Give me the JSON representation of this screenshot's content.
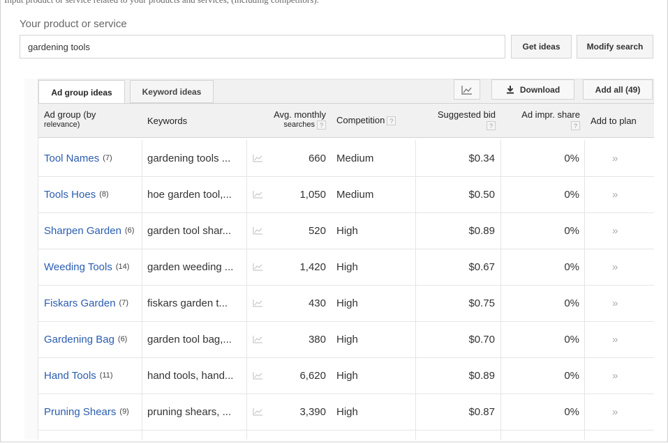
{
  "top_clip_text": "Input product or service related to your products and services, (including competitors).",
  "product": {
    "label": "Your product or service",
    "value": "gardening tools",
    "get_ideas": "Get ideas",
    "modify_search": "Modify search"
  },
  "tabs": {
    "ad_group": "Ad group ideas",
    "keyword": "Keyword ideas"
  },
  "toolbar": {
    "chart_icon": "chart-icon",
    "download": "Download",
    "add_all": "Add all (49)"
  },
  "headers": {
    "ad_group_line1": "Ad group (by",
    "ad_group_line2": "relevance)",
    "keywords": "Keywords",
    "searches_line1": "Avg. monthly",
    "searches_line2": "searches",
    "competition": "Competition",
    "bid": "Suggested bid",
    "share": "Ad impr. share",
    "add_to_plan": "Add to plan",
    "help": "?"
  },
  "rows": [
    {
      "name": "Tool Names",
      "count": "(7)",
      "keywords": "gardening tools ...",
      "searches": "660",
      "competition": "Medium",
      "bid": "$0.34",
      "share": "0%",
      "add": "»"
    },
    {
      "name": "Tools Hoes",
      "count": "(8)",
      "keywords": "hoe garden tool,...",
      "searches": "1,050",
      "competition": "Medium",
      "bid": "$0.50",
      "share": "0%",
      "add": "»"
    },
    {
      "name": "Sharpen Garden",
      "count": "(6)",
      "keywords": "garden tool shar...",
      "searches": "520",
      "competition": "High",
      "bid": "$0.89",
      "share": "0%",
      "add": "»"
    },
    {
      "name": "Weeding Tools",
      "count": "(14)",
      "keywords": "garden weeding ...",
      "searches": "1,420",
      "competition": "High",
      "bid": "$0.67",
      "share": "0%",
      "add": "»"
    },
    {
      "name": "Fiskars Garden",
      "count": "(7)",
      "keywords": "fiskars garden t...",
      "searches": "430",
      "competition": "High",
      "bid": "$0.75",
      "share": "0%",
      "add": "»"
    },
    {
      "name": "Gardening Bag",
      "count": "(6)",
      "keywords": "garden tool bag,...",
      "searches": "380",
      "competition": "High",
      "bid": "$0.70",
      "share": "0%",
      "add": "»"
    },
    {
      "name": "Hand Tools",
      "count": "(11)",
      "keywords": "hand tools, hand...",
      "searches": "6,620",
      "competition": "High",
      "bid": "$0.89",
      "share": "0%",
      "add": "»"
    },
    {
      "name": "Pruning Shears",
      "count": "(9)",
      "keywords": "pruning shears, ...",
      "searches": "3,390",
      "competition": "High",
      "bid": "$0.87",
      "share": "0%",
      "add": "»"
    }
  ],
  "colors": {
    "link": "#2a5db0",
    "accent": "#dd4b39"
  }
}
